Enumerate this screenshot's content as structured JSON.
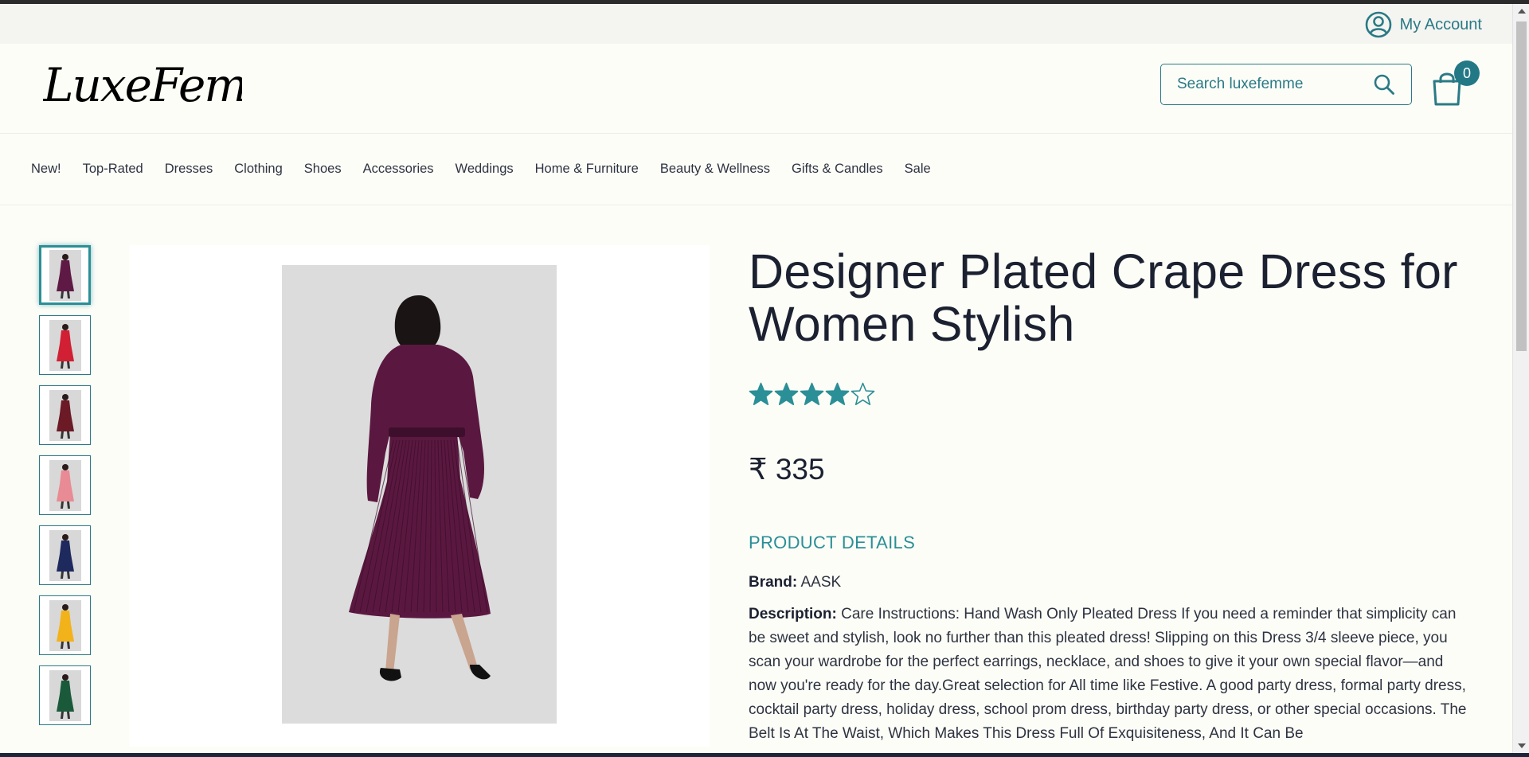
{
  "account": {
    "label": "My Account"
  },
  "logo": {
    "text": "LuxeFemme"
  },
  "search": {
    "placeholder": "Search luxefemme"
  },
  "cart": {
    "count": "0"
  },
  "nav": {
    "items": [
      "New!",
      "Top-Rated",
      "Dresses",
      "Clothing",
      "Shoes",
      "Accessories",
      "Weddings",
      "Home & Furniture",
      "Beauty & Wellness",
      "Gifts & Candles",
      "Sale"
    ]
  },
  "gallery": {
    "thumbnail_colors": [
      "#5e1a45",
      "#d11f34",
      "#6b1a26",
      "#e88b94",
      "#1e2a5e",
      "#f2b21a",
      "#1a5a3a"
    ],
    "active_index": 0,
    "main_dress_color": "#5a1840"
  },
  "product": {
    "title": "Designer Plated Crape Dress for Women Stylish",
    "rating": 4,
    "rating_max": 5,
    "price": "₹ 335",
    "details_heading": "PRODUCT DETAILS",
    "brand_label": "Brand:",
    "brand_value": "AASK",
    "description_label": "Description:",
    "description_text": "Care Instructions: Hand Wash Only Pleated Dress If you need a reminder that simplicity can be sweet and stylish, look no further than this pleated dress! Slipping on this Dress 3/4 sleeve piece, you scan your wardrobe for the perfect earrings, necklace, and shoes to give it your own special flavor—and now you're ready for the day.Great selection for All time like Festive. A good party dress, formal party dress, cocktail party dress, holiday dress, school prom dress, birthday party dress, or other special occasions. The Belt Is At The Waist, Which Makes This Dress Full Of Exquisiteness, And It Can Be"
  },
  "colors": {
    "accent": "#2a7a85",
    "star": "#2a8f96",
    "badge": "#237886"
  }
}
